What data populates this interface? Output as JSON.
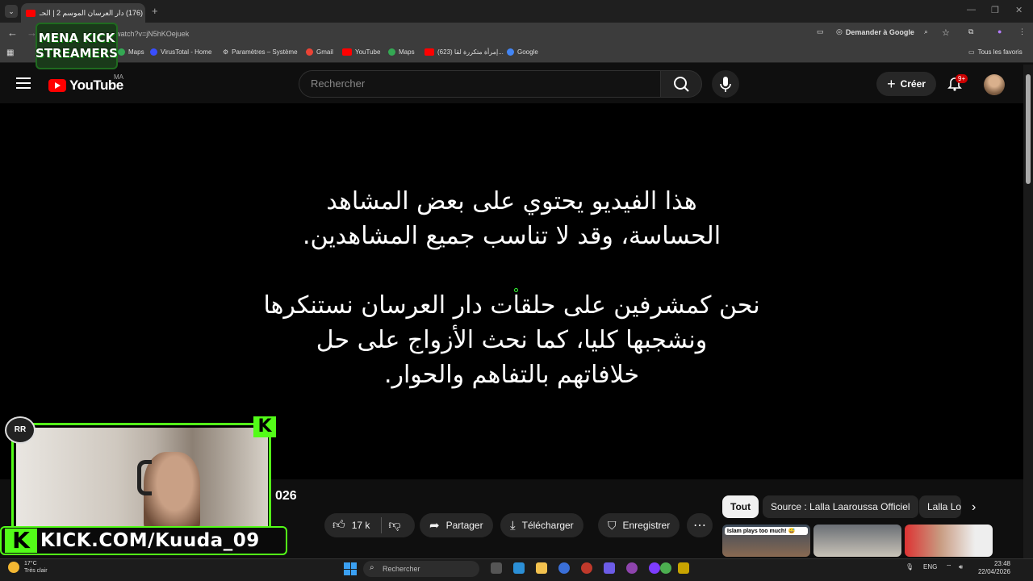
{
  "browser": {
    "tab_title": "(176) دار العرسان الموسم 2 | الحـ",
    "url": "om/watch?v=jN5hKOejuek",
    "ask_google": "Demander à Google",
    "bookmarks": [
      "Maps",
      "VirusTotal - Home",
      "Paramètres – Système",
      "Gmail",
      "YouTube",
      "Maps",
      "(623) إمرأة متكررة لقا...",
      "Google"
    ],
    "all_favorites": "Tous les favoris"
  },
  "youtube": {
    "logo_text": "YouTube",
    "region": "MA",
    "search_placeholder": "Rechercher",
    "create_label": "Créer",
    "notif_count": "9+"
  },
  "video": {
    "warning_line1": "هذا الفيديو يحتوي على بعض المشاهد\nالحساسة، وقد لا تناسب جميع المشاهدين.",
    "warning_line2": "نحن كمشرفين على حلقات دار العرسان نستنكرها\nونشجبها كليا، كما نحث الأزواج على حل\nخلافاتهم بالتفاهم والحوار."
  },
  "below": {
    "title_fragment": "026",
    "likes": "17 k",
    "share": "Partager",
    "download": "Télécharger",
    "save": "Enregistrer",
    "chips": [
      "Tout",
      "Source : Lalla Laaroussa Officiel",
      "Lalla Lo"
    ],
    "thumb1_caption": "Islam plays too much! 😅"
  },
  "overlays": {
    "mena_lines": [
      "MENA KICK",
      "STREAMERS"
    ],
    "kick_url": "KICK.COM/Kuuda_09",
    "kick_letter": "K"
  },
  "taskbar": {
    "temp": "17°C",
    "weather": "Très clair",
    "search_placeholder": "Rechercher",
    "lang": "ENG",
    "time": "23:48",
    "date": "22/04/2026"
  }
}
